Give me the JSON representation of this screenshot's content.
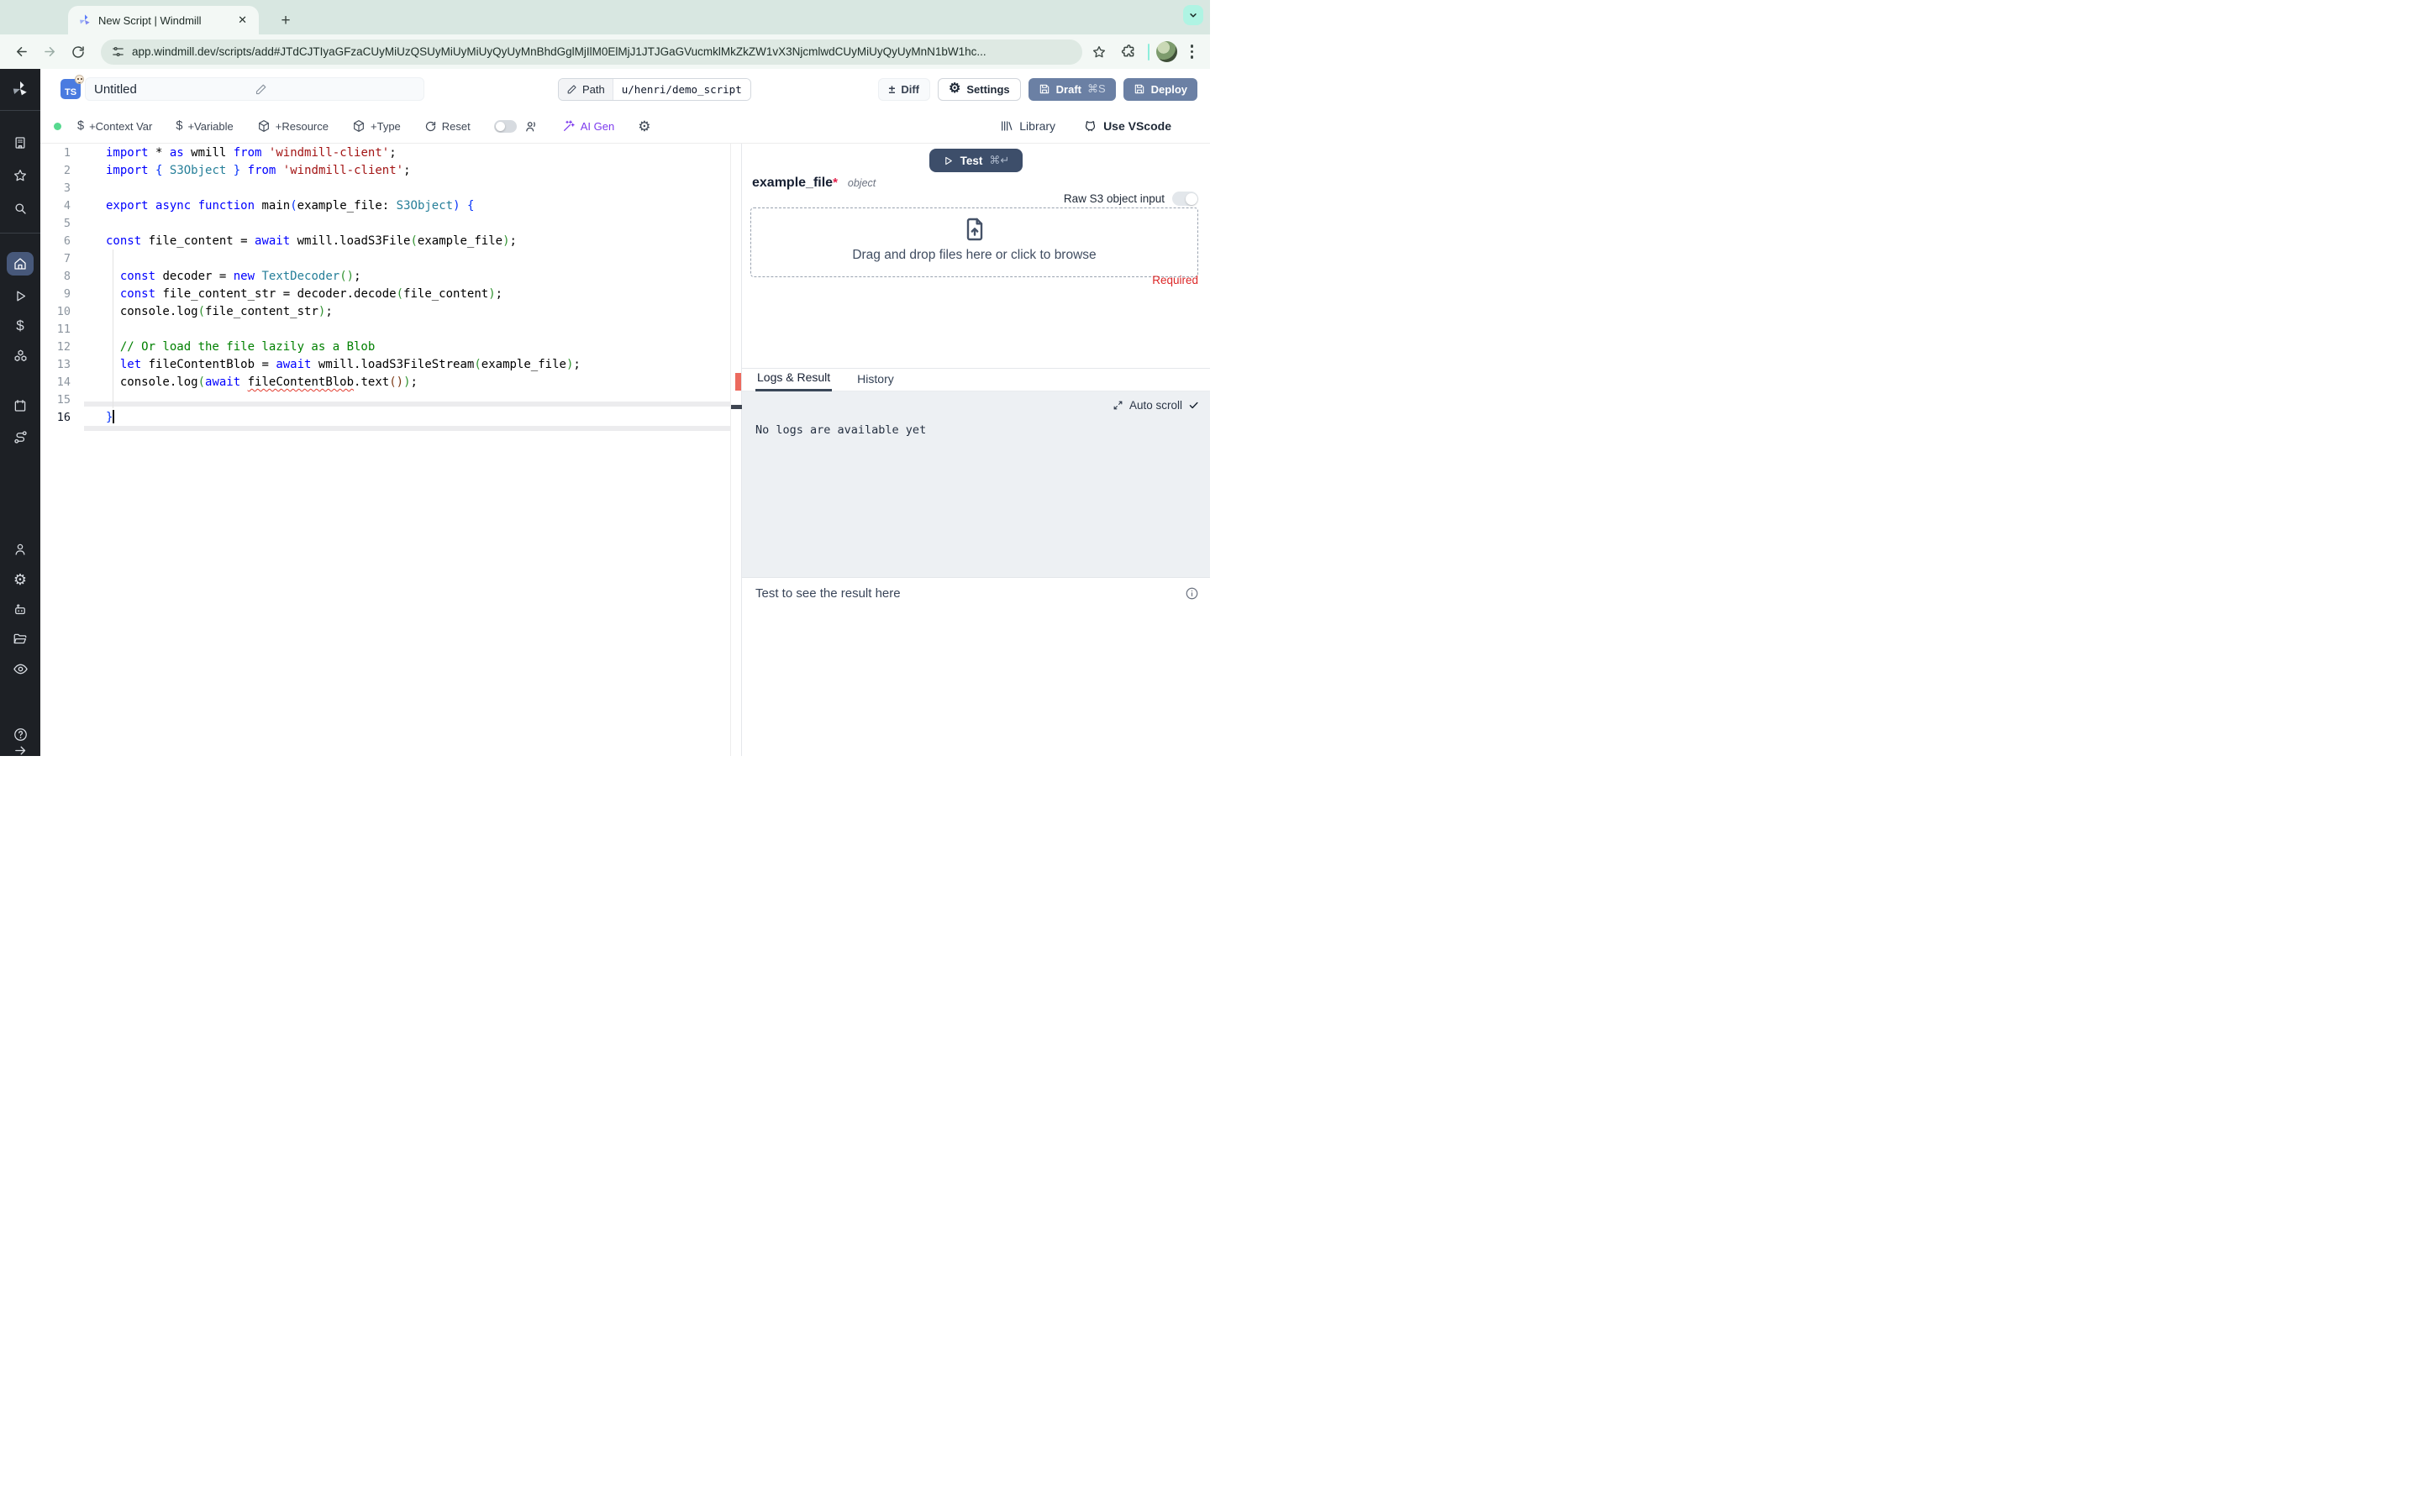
{
  "browser": {
    "tab_title": "New Script | Windmill",
    "url": "app.windmill.dev/scripts/add#JTdCJTIyaGFzaCUyMiUzQSUyMiUyMiUyQyUyMnBhdGglMjIlM0ElMjJ1JTJGaGVucmklMkZkZW1vX3NjcmlwdCUyMiUyQyUyMnN1bW1hc...",
    "new_tab": "+",
    "close_tab": "✕"
  },
  "header": {
    "lang_badge": "TS",
    "title": "Untitled",
    "path_label": "Path",
    "path_value": "u/henri/demo_script",
    "diff_label": "Diff",
    "diff_icon": "±",
    "settings_label": "Settings",
    "draft_label": "Draft",
    "draft_shortcut": "⌘S",
    "deploy_label": "Deploy"
  },
  "toolbar": {
    "context_var": "+Context Var",
    "variable": "+Variable",
    "resource": "+Resource",
    "type": "+Type",
    "reset": "Reset",
    "ai_gen": "AI Gen",
    "library": "Library",
    "use_vscode": "Use VScode",
    "dollar": "$",
    "gear": "⚙"
  },
  "editor": {
    "active_line": 16,
    "lines": [
      [
        [
          "kw",
          "import"
        ],
        [
          "pl",
          " * "
        ],
        [
          "kw",
          "as"
        ],
        [
          "pl",
          " wmill "
        ],
        [
          "kw",
          "from"
        ],
        [
          "pl",
          " "
        ],
        [
          "st",
          "'windmill-client'"
        ],
        [
          "pl",
          ";"
        ]
      ],
      [
        [
          "kw",
          "import"
        ],
        [
          "pl",
          " "
        ],
        [
          "b1",
          "{"
        ],
        [
          "pl",
          " "
        ],
        [
          "ty",
          "S3Object"
        ],
        [
          "pl",
          " "
        ],
        [
          "b1",
          "}"
        ],
        [
          "pl",
          " "
        ],
        [
          "kw",
          "from"
        ],
        [
          "pl",
          " "
        ],
        [
          "st",
          "'windmill-client'"
        ],
        [
          "pl",
          ";"
        ]
      ],
      [],
      [
        [
          "kw",
          "export"
        ],
        [
          "pl",
          " "
        ],
        [
          "kw",
          "async"
        ],
        [
          "pl",
          " "
        ],
        [
          "kw",
          "function"
        ],
        [
          "pl",
          " main"
        ],
        [
          "b1",
          "("
        ],
        [
          "pl",
          "example_file: "
        ],
        [
          "ty",
          "S3Object"
        ],
        [
          "b1",
          ")"
        ],
        [
          "pl",
          " "
        ],
        [
          "b1",
          "{"
        ]
      ],
      [],
      [
        [
          "kw",
          "const"
        ],
        [
          "pl",
          " file_content = "
        ],
        [
          "kw",
          "await"
        ],
        [
          "pl",
          " wmill.loadS3File"
        ],
        [
          "b2",
          "("
        ],
        [
          "pl",
          "example_file"
        ],
        [
          "b2",
          ")"
        ],
        [
          "pl",
          ";"
        ]
      ],
      [],
      [
        [
          "pl",
          "  "
        ],
        [
          "kw",
          "const"
        ],
        [
          "pl",
          " decoder = "
        ],
        [
          "kw",
          "new"
        ],
        [
          "pl",
          " "
        ],
        [
          "ty",
          "TextDecoder"
        ],
        [
          "b2",
          "("
        ],
        [
          "b2",
          ")"
        ],
        [
          "pl",
          ";"
        ]
      ],
      [
        [
          "pl",
          "  "
        ],
        [
          "kw",
          "const"
        ],
        [
          "pl",
          " file_content_str = decoder.decode"
        ],
        [
          "b2",
          "("
        ],
        [
          "pl",
          "file_content"
        ],
        [
          "b2",
          ")"
        ],
        [
          "pl",
          ";"
        ]
      ],
      [
        [
          "pl",
          "  console.log"
        ],
        [
          "b2",
          "("
        ],
        [
          "pl",
          "file_content_str"
        ],
        [
          "b2",
          ")"
        ],
        [
          "pl",
          ";"
        ]
      ],
      [],
      [
        [
          "cm",
          "  // Or load the file lazily as a Blob"
        ]
      ],
      [
        [
          "pl",
          "  "
        ],
        [
          "kw",
          "let"
        ],
        [
          "pl",
          " fileContentBlob = "
        ],
        [
          "kw",
          "await"
        ],
        [
          "pl",
          " wmill.loadS3FileStream"
        ],
        [
          "b2",
          "("
        ],
        [
          "pl",
          "example_file"
        ],
        [
          "b2",
          ")"
        ],
        [
          "pl",
          ";"
        ]
      ],
      [
        [
          "pl",
          "  console.log"
        ],
        [
          "b2",
          "("
        ],
        [
          "kw",
          "await"
        ],
        [
          "pl",
          " "
        ],
        [
          "pl err",
          "fileContentBlob"
        ],
        [
          "pl",
          ".text"
        ],
        [
          "b3",
          "("
        ],
        [
          "b3",
          ")"
        ],
        [
          "b2",
          ")"
        ],
        [
          "pl",
          ";"
        ]
      ],
      [],
      [
        [
          "b1",
          "}"
        ]
      ]
    ]
  },
  "panel": {
    "test_label": "Test",
    "test_shortcut": "⌘↵",
    "arg_name": "example_file",
    "required_marker": "*",
    "arg_type": "object",
    "raw_s3_label": "Raw S3 object input",
    "dropzone_text": "Drag and drop files here or click to browse",
    "required_text": "Required",
    "tab_logs": "Logs & Result",
    "tab_history": "History",
    "auto_scroll": "Auto scroll",
    "no_logs": "No logs are available yet",
    "result_hint": "Test to see the result here"
  },
  "colors": {
    "accent_slate": "#6b80a4",
    "test_navy": "#3d4e6a",
    "ai_purple": "#7c3aed",
    "required_red": "#dc2626",
    "chrome_mint": "#aff4e3",
    "sidebar_dark": "#1d2025",
    "error_marker": "#ec6a5e"
  }
}
